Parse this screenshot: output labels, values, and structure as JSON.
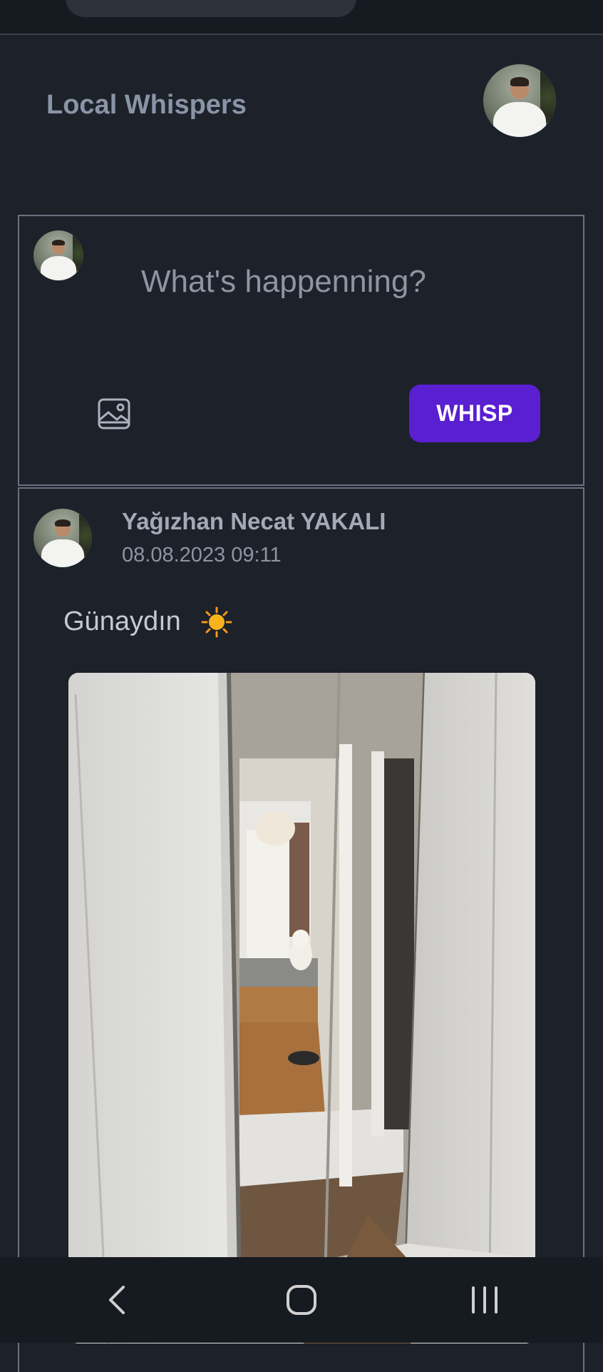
{
  "header": {
    "app_title": "Local Whispers"
  },
  "composer": {
    "placeholder": "What's happenning?",
    "submit_label": "WHISP"
  },
  "post": {
    "author": "Yağızhan Necat YAKALI",
    "timestamp": "08.08.2023 09:11",
    "text": "Günaydın",
    "emoji_icon": "sun-icon"
  },
  "icons": {
    "composer_media": "image-icon",
    "nav_back": "back-chevron-icon",
    "nav_home": "home-icon",
    "nav_recents": "recents-icon"
  },
  "colors": {
    "background": "#1c212a",
    "accent": "#5a1fd0",
    "border": "#6a7280"
  }
}
